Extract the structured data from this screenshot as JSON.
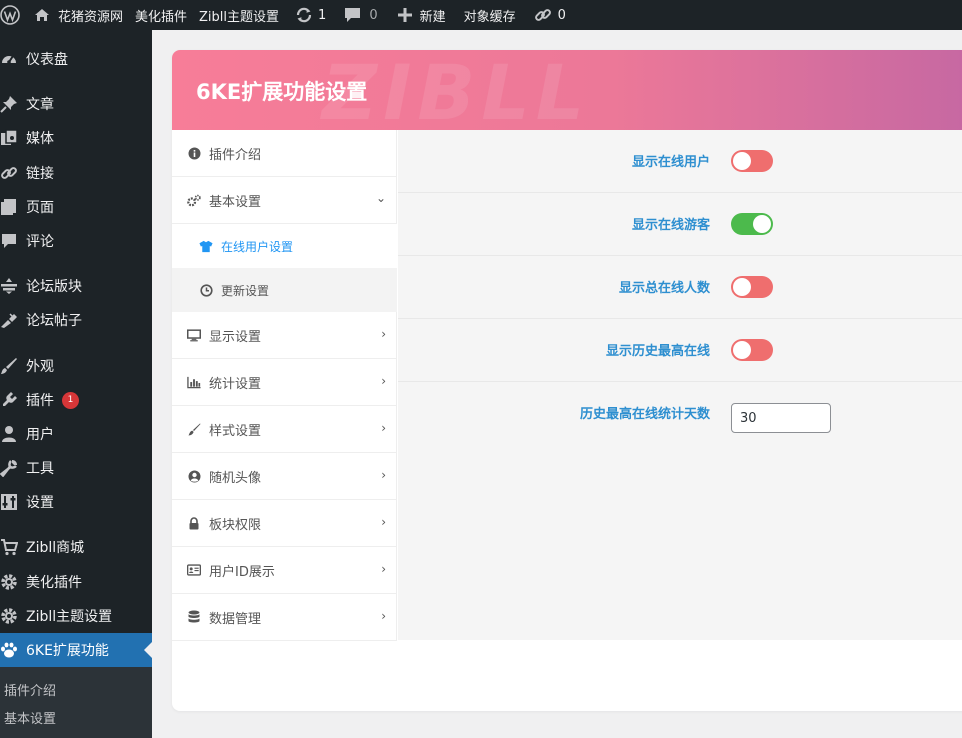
{
  "adminbar": {
    "items": [
      {
        "name": "wordpress-logo",
        "label": ""
      },
      {
        "name": "site-name",
        "label": "花猪资源网"
      },
      {
        "name": "beautify-plugin",
        "label": "美化插件"
      },
      {
        "name": "zibll-theme-settings",
        "label": "Zibll主题设置"
      },
      {
        "name": "updates",
        "count": "1"
      },
      {
        "name": "comments",
        "count": "0"
      },
      {
        "name": "new",
        "label": "新建"
      },
      {
        "name": "object-cache",
        "label": "对象缓存"
      },
      {
        "name": "links",
        "count": "0"
      }
    ]
  },
  "sidebar": {
    "items": [
      {
        "label": "仪表盘",
        "icon": "dashboard-icon"
      },
      {
        "label": "文章",
        "icon": "pin-icon"
      },
      {
        "label": "媒体",
        "icon": "media-icon"
      },
      {
        "label": "链接",
        "icon": "link-icon"
      },
      {
        "label": "页面",
        "icon": "page-icon"
      },
      {
        "label": "评论",
        "icon": "comment-icon"
      },
      {
        "label": "论坛版块",
        "icon": "forum-icon"
      },
      {
        "label": "论坛帖子",
        "icon": "forum-post-icon"
      },
      {
        "label": "外观",
        "icon": "brush-icon"
      },
      {
        "label": "插件",
        "icon": "plugin-icon",
        "badge": "1"
      },
      {
        "label": "用户",
        "icon": "user-icon"
      },
      {
        "label": "工具",
        "icon": "wrench-icon"
      },
      {
        "label": "设置",
        "icon": "settings-icon"
      },
      {
        "label": "Zibll商城",
        "icon": "cart-icon"
      },
      {
        "label": "美化插件",
        "icon": "gear-icon"
      },
      {
        "label": "Zibll主题设置",
        "icon": "gear-icon"
      },
      {
        "label": "6KE扩展功能",
        "icon": "paw-icon",
        "active": true
      }
    ],
    "submenu": [
      "插件介绍",
      "基本设置"
    ]
  },
  "panel": {
    "title": "6KE扩展功能设置",
    "watermark": "ZIBLL",
    "nav": [
      {
        "label": "插件介绍",
        "icon": "info-icon"
      },
      {
        "label": "基本设置",
        "icon": "cogs-icon",
        "expanded": true
      },
      {
        "label": "在线用户设置",
        "icon": "shirt-icon",
        "sub": true,
        "current": true
      },
      {
        "label": "更新设置",
        "icon": "clock-icon",
        "sub": true
      },
      {
        "label": "显示设置",
        "icon": "monitor-icon"
      },
      {
        "label": "统计设置",
        "icon": "bar-chart-icon"
      },
      {
        "label": "样式设置",
        "icon": "brush-icon"
      },
      {
        "label": "随机头像",
        "icon": "user-circle-icon"
      },
      {
        "label": "板块权限",
        "icon": "lock-icon"
      },
      {
        "label": "用户ID展示",
        "icon": "id-card-icon"
      },
      {
        "label": "数据管理",
        "icon": "database-icon"
      }
    ],
    "fields": [
      {
        "label": "显示在线用户",
        "type": "toggle",
        "value": false
      },
      {
        "label": "显示在线游客",
        "type": "toggle",
        "value": true
      },
      {
        "label": "显示总在线人数",
        "type": "toggle",
        "value": false
      },
      {
        "label": "显示历史最高在线",
        "type": "toggle",
        "value": false
      },
      {
        "label": "历史最高在线统计天数",
        "type": "number",
        "value": "30"
      }
    ]
  },
  "colors": {
    "adminbar_bg": "#1d2327",
    "active_menu": "#2271b1",
    "header_start": "#f77d98",
    "header_end": "#c668a2",
    "label_blue": "#2e8fd0",
    "toggle_off": "#ef6e6e",
    "toggle_on": "#4cba4c"
  }
}
